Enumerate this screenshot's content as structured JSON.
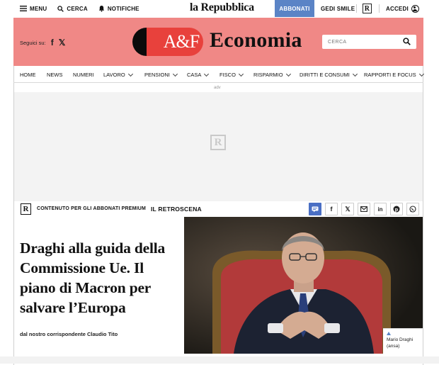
{
  "topbar": {
    "menu_label": "MENU",
    "search_label": "CERCA",
    "notifications_label": "NOTIFICHE",
    "brand": "la Repubblica",
    "subscribe_label": "ABBONATI",
    "gedi_label": "GEDI SMILE",
    "r_logo": "R",
    "login_label": "ACCEDI"
  },
  "header": {
    "follow_label": "Seguici su:",
    "social_facebook": "f",
    "social_x": "𝕏",
    "af_logo": "A&F",
    "section_title": "Economia",
    "search_placeholder": "CERCA"
  },
  "nav": {
    "items": [
      {
        "label": "HOME",
        "dropdown": false
      },
      {
        "label": "NEWS",
        "dropdown": false
      },
      {
        "label": "NUMERI",
        "dropdown": false
      },
      {
        "label": "LAVORO",
        "dropdown": true
      },
      {
        "label": "PENSIONI",
        "dropdown": true
      },
      {
        "label": "CASA",
        "dropdown": true
      },
      {
        "label": "FISCO",
        "dropdown": true
      },
      {
        "label": "RISPARMIO",
        "dropdown": true
      },
      {
        "label": "DIRITTI E CONSUMI",
        "dropdown": true
      },
      {
        "label": "RAPPORTI E FOCUS",
        "dropdown": true
      }
    ]
  },
  "ad": {
    "label": "adv",
    "placeholder_logo": "R"
  },
  "premium_bar": {
    "r_logo": "R",
    "label": "CONTENUTO PER GLI ABBONATI PREMIUM",
    "section": "IL RETROSCENA",
    "share_icons": [
      "comment-icon",
      "facebook-icon",
      "x-icon",
      "email-icon",
      "linkedin-icon",
      "pinterest-icon",
      "whatsapp-icon"
    ]
  },
  "article": {
    "headline": "Draghi alla guida della Commissione Ue. Il piano di Macron per salvare l’Europa",
    "byline": "dal nostro corrispondente Claudio Tito",
    "photo_caption": "Mario Draghi (ansa)"
  },
  "colors": {
    "header_bg": "#f08886",
    "af_red": "#e8413c",
    "subscribe_blue": "#5b84c6",
    "comment_blue": "#4a6fc4"
  }
}
